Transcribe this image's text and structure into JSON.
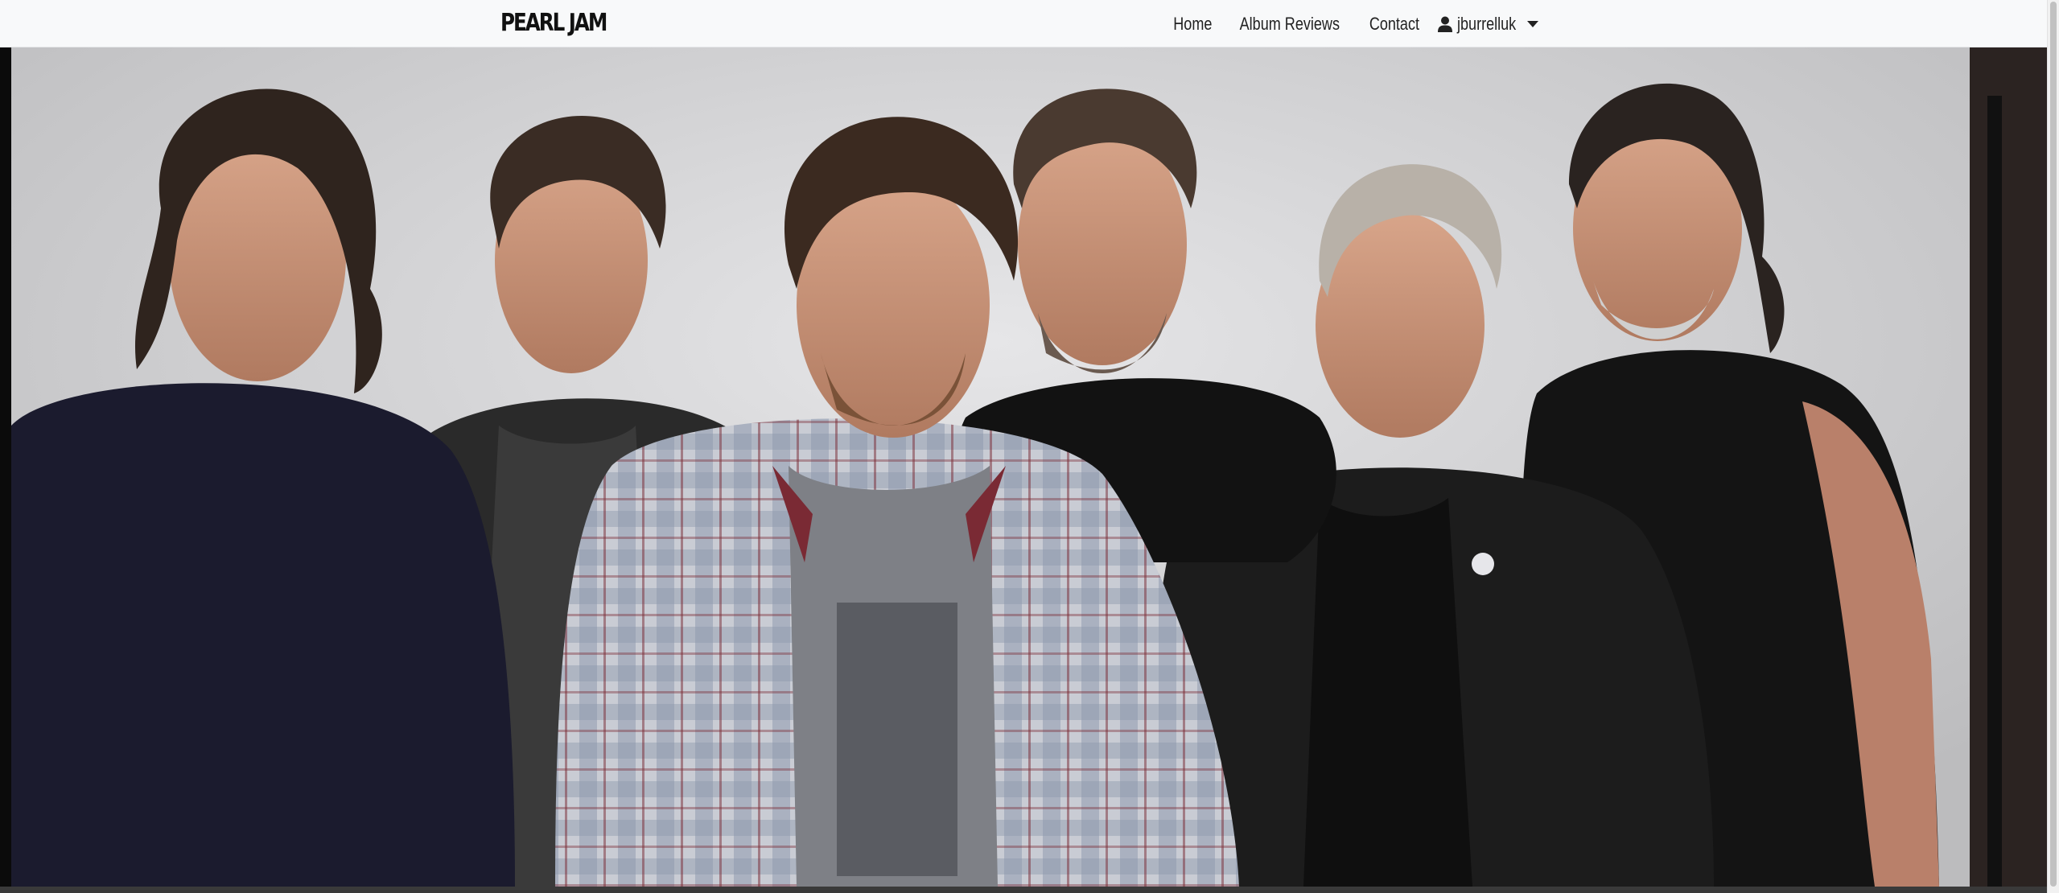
{
  "navbar": {
    "brand": "PEARL JAM",
    "links": {
      "home": "Home",
      "album_reviews": "Album Reviews",
      "contact": "Contact"
    },
    "user": {
      "name": "jburrelluk",
      "icon": "user-icon"
    },
    "background": "#f8f9fa"
  },
  "hero": {
    "description_icon": "band-photo"
  }
}
